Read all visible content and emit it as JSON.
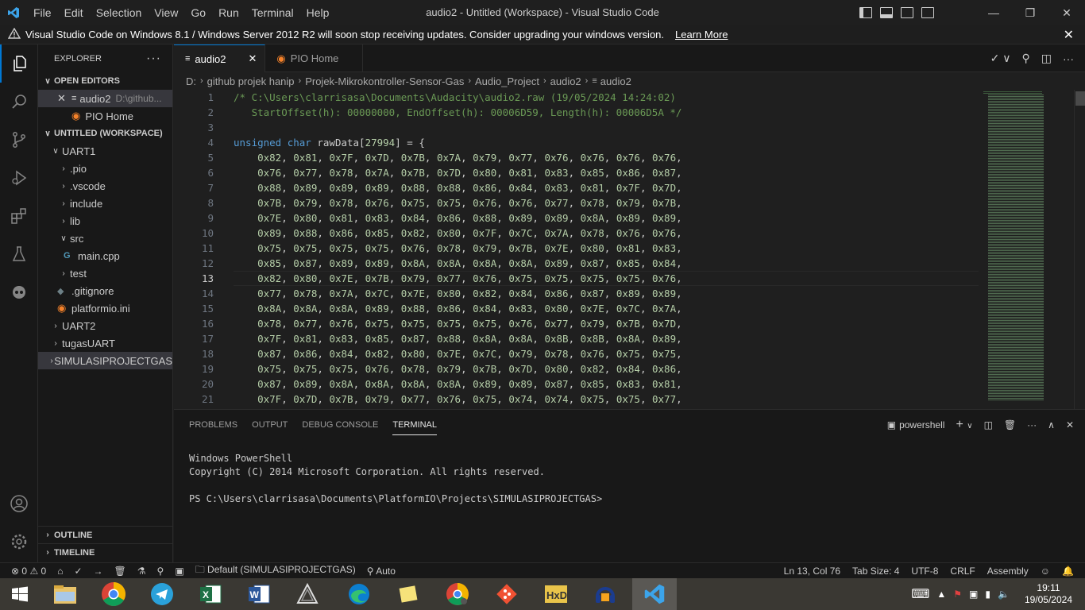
{
  "titlebar": {
    "menu": [
      "File",
      "Edit",
      "Selection",
      "View",
      "Go",
      "Run",
      "Terminal",
      "Help"
    ],
    "title": "audio2 - Untitled (Workspace) - Visual Studio Code"
  },
  "notification": {
    "text": "Visual Studio Code on Windows 8.1 / Windows Server 2012 R2 will soon stop receiving updates. Consider upgrading your windows version.",
    "link": "Learn More"
  },
  "sidebar": {
    "title": "EXPLORER",
    "open_editors": "OPEN EDITORS",
    "open_files": [
      {
        "name": "audio2",
        "path": "D:\\github..."
      },
      {
        "name": "PIO Home",
        "path": ""
      }
    ],
    "workspace": "UNTITLED (WORKSPACE)",
    "tree": [
      {
        "label": "UART1",
        "kind": "folder-open"
      },
      {
        "label": ".pio",
        "kind": "folder"
      },
      {
        "label": ".vscode",
        "kind": "folder"
      },
      {
        "label": "include",
        "kind": "folder"
      },
      {
        "label": "lib",
        "kind": "folder"
      },
      {
        "label": "src",
        "kind": "folder-open"
      },
      {
        "label": "main.cpp",
        "kind": "file"
      },
      {
        "label": "test",
        "kind": "folder"
      },
      {
        "label": ".gitignore",
        "kind": "file"
      },
      {
        "label": "platformio.ini",
        "kind": "file"
      },
      {
        "label": "UART2",
        "kind": "folder"
      },
      {
        "label": "tugasUART",
        "kind": "folder"
      },
      {
        "label": "SIMULASIPROJECTGAS",
        "kind": "folder"
      }
    ],
    "outline": "OUTLINE",
    "timeline": "TIMELINE"
  },
  "tabs": [
    {
      "label": "audio2",
      "active": true
    },
    {
      "label": "PIO Home",
      "active": false
    }
  ],
  "breadcrumb": [
    "D:",
    "github projek hanip",
    "Projek-Mikrokontroller-Sensor-Gas",
    "Audio_Project",
    "audio2",
    "audio2"
  ],
  "editor": {
    "line_numbers": [
      "1",
      "2",
      "3",
      "4",
      "5",
      "6",
      "7",
      "8",
      "9",
      "10",
      "11",
      "12",
      "13",
      "14",
      "15",
      "16",
      "17",
      "18",
      "19",
      "20",
      "21"
    ],
    "current_line": "13",
    "comment1": "/* C:\\Users\\clarrisasa\\Documents\\Audacity\\audio2.raw (19/05/2024 14:24:02)",
    "comment2": "   StartOffset(h): 00000000, EndOffset(h): 00006D59, Length(h): 00006D5A */",
    "decl_kw": "unsigned char",
    "decl_name": " rawData[",
    "decl_size": "27994",
    "decl_end": "] = {",
    "rows": [
      "    0x82, 0x81, 0x7F, 0x7D, 0x7B, 0x7A, 0x79, 0x77, 0x76, 0x76, 0x76, 0x76,",
      "    0x76, 0x77, 0x78, 0x7A, 0x7B, 0x7D, 0x80, 0x81, 0x83, 0x85, 0x86, 0x87,",
      "    0x88, 0x89, 0x89, 0x89, 0x88, 0x88, 0x86, 0x84, 0x83, 0x81, 0x7F, 0x7D,",
      "    0x7B, 0x79, 0x78, 0x76, 0x75, 0x75, 0x76, 0x76, 0x77, 0x78, 0x79, 0x7B,",
      "    0x7E, 0x80, 0x81, 0x83, 0x84, 0x86, 0x88, 0x89, 0x89, 0x8A, 0x89, 0x89,",
      "    0x89, 0x88, 0x86, 0x85, 0x82, 0x80, 0x7F, 0x7C, 0x7A, 0x78, 0x76, 0x76,",
      "    0x75, 0x75, 0x75, 0x75, 0x76, 0x78, 0x79, 0x7B, 0x7E, 0x80, 0x81, 0x83,",
      "    0x85, 0x87, 0x89, 0x89, 0x8A, 0x8A, 0x8A, 0x8A, 0x89, 0x87, 0x85, 0x84,",
      "    0x82, 0x80, 0x7E, 0x7B, 0x79, 0x77, 0x76, 0x75, 0x75, 0x75, 0x75, 0x76,",
      "    0x77, 0x78, 0x7A, 0x7C, 0x7E, 0x80, 0x82, 0x84, 0x86, 0x87, 0x89, 0x89,",
      "    0x8A, 0x8A, 0x8A, 0x89, 0x88, 0x86, 0x84, 0x83, 0x80, 0x7E, 0x7C, 0x7A,",
      "    0x78, 0x77, 0x76, 0x75, 0x75, 0x75, 0x75, 0x76, 0x77, 0x79, 0x7B, 0x7D,",
      "    0x7F, 0x81, 0x83, 0x85, 0x87, 0x88, 0x8A, 0x8A, 0x8B, 0x8B, 0x8A, 0x89,",
      "    0x87, 0x86, 0x84, 0x82, 0x80, 0x7E, 0x7C, 0x79, 0x78, 0x76, 0x75, 0x75,",
      "    0x75, 0x75, 0x75, 0x76, 0x78, 0x79, 0x7B, 0x7D, 0x80, 0x82, 0x84, 0x86,",
      "    0x87, 0x89, 0x8A, 0x8A, 0x8A, 0x8A, 0x89, 0x89, 0x87, 0x85, 0x83, 0x81,",
      "    0x7F, 0x7D, 0x7B, 0x79, 0x77, 0x76, 0x75, 0x74, 0x74, 0x75, 0x75, 0x77,"
    ]
  },
  "panel": {
    "tabs": [
      "PROBLEMS",
      "OUTPUT",
      "DEBUG CONSOLE",
      "TERMINAL"
    ],
    "active_tab": "TERMINAL",
    "shell": "powershell",
    "terminal_lines": [
      "Windows PowerShell",
      "Copyright (C) 2014 Microsoft Corporation. All rights reserved.",
      "",
      "PS C:\\Users\\clarrisasa\\Documents\\PlatformIO\\Projects\\SIMULASIPROJECTGAS>"
    ]
  },
  "statusbar": {
    "errors": "0",
    "warnings": "0",
    "env": "Default (SIMULASIPROJECTGAS)",
    "auto": "Auto",
    "position": "Ln 13, Col 76",
    "tabsize": "Tab Size: 4",
    "encoding": "UTF-8",
    "eol": "CRLF",
    "language": "Assembly"
  },
  "taskbar": {
    "time": "19:11",
    "date": "19/05/2024"
  },
  "colors": {
    "accent": "#0078d4",
    "comment": "#6a9955",
    "keyword": "#569cd6",
    "number": "#b5cea8"
  }
}
